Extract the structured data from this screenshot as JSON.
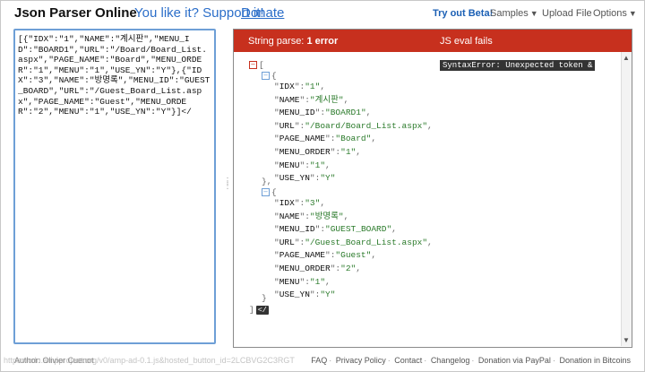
{
  "header": {
    "title": "Json Parser Online",
    "support_text": "You like it? Support it!",
    "donate_label": "Donate",
    "nav": {
      "try_beta": "Try out Beta!",
      "samples": "Samples",
      "upload": "Upload File",
      "options": "Options"
    }
  },
  "editor": {
    "value": "[{\"IDX\":\"1\",\"NAME\":\"계시판\",\"MENU_ID\":\"BOARD1\",\"URL\":\"/Board/Board_List.aspx\",\"PAGE_NAME\":\"Board\",\"MENU_ORDER\":\"1\",\"MENU\":\"1\",\"USE_YN\":\"Y\"},{\"IDX\":\"3\",\"NAME\":\"방명록\",\"MENU_ID\":\"GUEST_BOARD\",\"URL\":\"/Guest_Board_List.aspx\",\"PAGE_NAME\":\"Guest\",\"MENU_ORDER\":\"2\",\"MENU\":\"1\",\"USE_YN\":\"Y\"}]</"
  },
  "viewer": {
    "error_prefix": "String parse:",
    "error_count": "1 error",
    "js_eval": "JS eval fails",
    "syntax_error": "SyntaxError: Unexpected token &",
    "error_tag": "</",
    "lines": [
      "IDX",
      "1",
      "NAME",
      "계시판",
      "MENU_ID",
      "BOARD1",
      "URL",
      "/Board/Board_List.aspx",
      "PAGE_NAME",
      "Board",
      "MENU_ORDER",
      "1",
      "MENU",
      "1",
      "USE_YN",
      "Y",
      "IDX",
      "3",
      "NAME",
      "방명록",
      "MENU_ID",
      "GUEST_BOARD",
      "URL",
      "/Guest_Board_List.aspx",
      "PAGE_NAME",
      "Guest",
      "MENU_ORDER",
      "2",
      "MENU",
      "1",
      "USE_YN",
      "Y"
    ]
  },
  "footer": {
    "author": "Author: Olivier Cuenot",
    "ghost_url": "https://cdn.ampproject.org/v0/amp-ad-0.1.js&hosted_button_id=2LCBVG2C3RGT",
    "links": [
      "FAQ",
      "Privacy Policy",
      "Contact",
      "Changelog",
      "Donation via PayPal",
      "Donation in Bitcoins"
    ]
  },
  "colors": {
    "error_bar": "#c7301e",
    "link_blue": "#2b6ec9",
    "editor_border": "#6e9fd6",
    "value_green": "#2a7a2a"
  },
  "icons": {
    "collapse_array": "minus-square-red",
    "collapse_object": "minus-square-blue"
  }
}
